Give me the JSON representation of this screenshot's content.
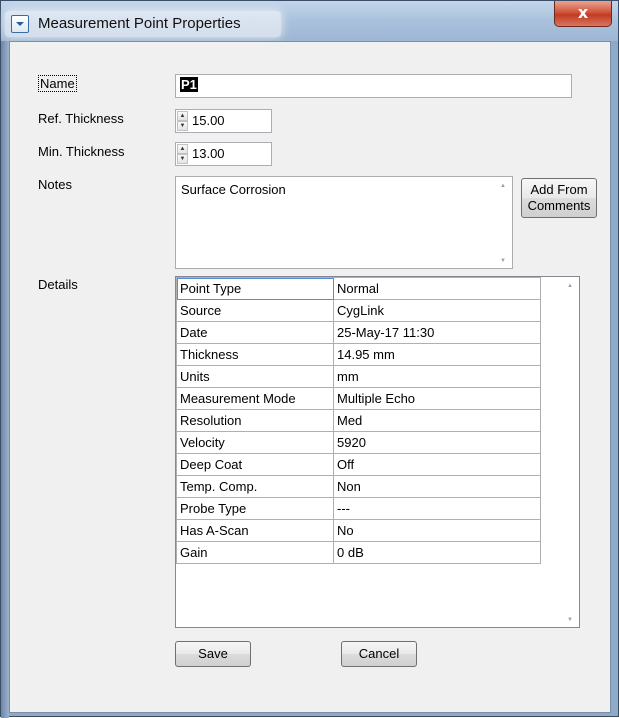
{
  "window": {
    "title": "Measurement Point Properties",
    "close_glyph": "x"
  },
  "form": {
    "name_label": "Name",
    "name_value": "P1",
    "ref_label": "Ref. Thickness",
    "ref_value": "15.00",
    "min_label": "Min. Thickness",
    "min_value": "13.00",
    "notes_label": "Notes",
    "notes_value": "Surface Corrosion",
    "add_from_comments_line1": "Add From",
    "add_from_comments_line2": "Comments",
    "details_label": "Details"
  },
  "details": {
    "rows": [
      {
        "key": "Point Type",
        "value": "Normal"
      },
      {
        "key": "Source",
        "value": "CygLink"
      },
      {
        "key": "Date",
        "value": "25-May-17 11:30"
      },
      {
        "key": "Thickness",
        "value": "14.95 mm"
      },
      {
        "key": "Units",
        "value": "mm"
      },
      {
        "key": "Measurement Mode",
        "value": "Multiple Echo"
      },
      {
        "key": "Resolution",
        "value": "Med"
      },
      {
        "key": "Velocity",
        "value": "5920"
      },
      {
        "key": "Deep Coat",
        "value": "Off"
      },
      {
        "key": "Temp. Comp.",
        "value": "Non"
      },
      {
        "key": "Probe Type",
        "value": "---"
      },
      {
        "key": "Has A-Scan",
        "value": "No"
      },
      {
        "key": "Gain",
        "value": "0 dB"
      }
    ]
  },
  "buttons": {
    "save": "Save",
    "cancel": "Cancel"
  }
}
